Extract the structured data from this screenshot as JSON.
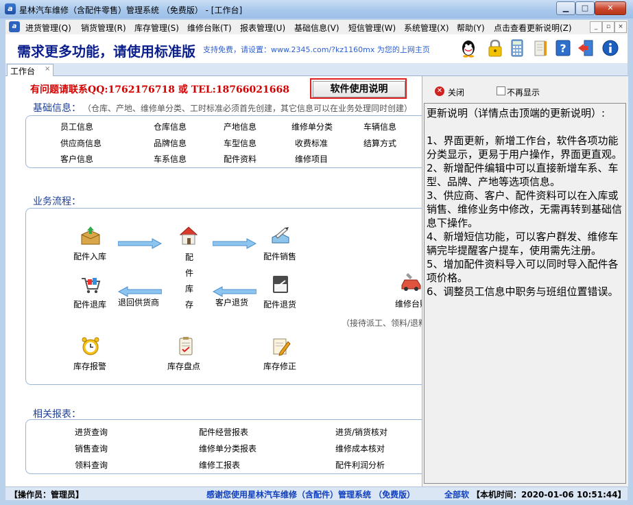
{
  "window": {
    "title": "星林汽车维修（含配件零售）管理系统 （免费版） - [工作台]",
    "min_glyph": "▁",
    "max_glyph": "□",
    "close_glyph": "✕"
  },
  "menu": {
    "items": [
      "进货管理(Q)",
      "销货管理(R)",
      "库存管理(S)",
      "维修台账(T)",
      "报表管理(U)",
      "基础信息(V)",
      "短信管理(W)",
      "系统管理(X)",
      "帮助(Y)",
      "点击查看更新说明(Z)"
    ],
    "mdi_min": "_",
    "mdi_restore": "▫",
    "mdi_close": "×"
  },
  "banner": {
    "main": "需求更多功能，请使用标准版",
    "sub": "支持免费，请设置：www.2345.com/?kz1160mx 为您的上网主页",
    "icons": [
      "qq-icon",
      "lock-icon",
      "calculator-icon",
      "notebook-icon",
      "help-icon",
      "exit-icon",
      "info-icon"
    ]
  },
  "tab": {
    "label": "工作台",
    "close": "×"
  },
  "main": {
    "contact": "有问题请联系QQ:1762176718 或 TEL:18766021668",
    "manual_button": "软件使用说明",
    "basic": {
      "title": "基础信息：",
      "note": "（仓库、产地、维修单分类、工时标准必须首先创建，其它信息可以在业务处理同时创建）",
      "rows": [
        [
          "员工信息",
          "仓库信息",
          "产地信息",
          "维修单分类",
          "车辆信息"
        ],
        [
          "供应商信息",
          "品牌信息",
          "车型信息",
          "收费标准",
          "结算方式"
        ],
        [
          "客户信息",
          "车系信息",
          "配件资料",
          "维修项目",
          ""
        ]
      ]
    },
    "flow": {
      "title": "业务流程：",
      "purchase_in": "配件入库",
      "stock_vertical": [
        "配",
        "件",
        "库",
        "存"
      ],
      "parts_sales": "配件销售",
      "purchase_return": "配件退库",
      "return_supplier": "退回供货商",
      "customer_return": "客户退货",
      "parts_return": "配件退货",
      "repair_desk": "维修台账",
      "repair_note": "（接待派工、领料/退料",
      "stock_alert": "库存报警",
      "stock_check": "库存盘点",
      "stock_adjust": "库存修正"
    },
    "reports": {
      "title": "相关报表：",
      "rows": [
        [
          "进货查询",
          "配件经营报表",
          "进货/销货核对"
        ],
        [
          "销售查询",
          "维修单分类报表",
          "维修成本核对"
        ],
        [
          "领料查询",
          "维修工报表",
          "配件利润分析"
        ]
      ]
    }
  },
  "right_panel": {
    "close_label": "关闭",
    "close_glyph": "✕",
    "no_show_label": "不再显示",
    "notes": "更新说明（详情点击顶端的更新说明）:\n\n1、界面更新，新增工作台，软件各项功能分类显示，更易于用户操作，界面更直观。\n2、新增配件编辑中可以直接新增车系、车型、品牌、产地等选项信息。\n3、供应商、客户、配件资料可以在入库或销售、维修业务中修改，无需再转到基础信息下操作。\n4、新增短信功能，可以客户群发、维修车辆完毕提醒客户提车，使用需先注册。\n5、增加配件资料导入可以同时导入配件各项价格。\n6、调整员工信息中职务与班组位置错误。"
  },
  "status": {
    "operator": "【操作员：管理员】",
    "thanks": "感谢您使用星林汽车维修（含配件）管理系统 （免费版）",
    "brand": "全部软",
    "time": "【本机时间：2020-01-06 10:51:44】"
  },
  "colors": {
    "title_blue": "#0b1f8c",
    "contact_red": "#d40000",
    "section_blue": "#1d3f98",
    "arrow_blue": "#5aa7e6",
    "status_blue": "#1040c0"
  }
}
